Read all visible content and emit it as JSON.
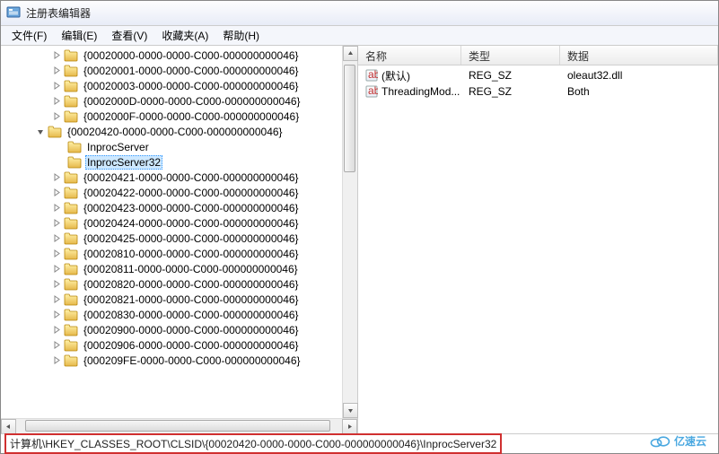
{
  "window": {
    "title": "注册表编辑器"
  },
  "menus": {
    "file": "文件(F)",
    "edit": "编辑(E)",
    "view": "查看(V)",
    "favorites": "收藏夹(A)",
    "help": "帮助(H)"
  },
  "tree": {
    "indent_base": 56,
    "open_key": "{00020420-0000-0000-C000-000000000046}",
    "children": [
      "InprocServer",
      "InprocServer32"
    ],
    "selected_child": "InprocServer32",
    "siblings_before": [
      "{00020000-0000-0000-C000-000000000046}",
      "{00020001-0000-0000-C000-000000000046}",
      "{00020003-0000-0000-C000-000000000046}",
      "{0002000D-0000-0000-C000-000000000046}",
      "{0002000F-0000-0000-C000-000000000046}"
    ],
    "siblings_after": [
      "{00020421-0000-0000-C000-000000000046}",
      "{00020422-0000-0000-C000-000000000046}",
      "{00020423-0000-0000-C000-000000000046}",
      "{00020424-0000-0000-C000-000000000046}",
      "{00020425-0000-0000-C000-000000000046}",
      "{00020810-0000-0000-C000-000000000046}",
      "{00020811-0000-0000-C000-000000000046}",
      "{00020820-0000-0000-C000-000000000046}",
      "{00020821-0000-0000-C000-000000000046}",
      "{00020830-0000-0000-C000-000000000046}",
      "{00020900-0000-0000-C000-000000000046}",
      "{00020906-0000-0000-C000-000000000046}",
      "{000209FE-0000-0000-C000-000000000046}"
    ]
  },
  "list": {
    "headers": {
      "name": "名称",
      "type": "类型",
      "data": "数据"
    },
    "rows": [
      {
        "name": "(默认)",
        "type": "REG_SZ",
        "data": "oleaut32.dll"
      },
      {
        "name": "ThreadingMod...",
        "type": "REG_SZ",
        "data": "Both"
      }
    ]
  },
  "status": {
    "path": "计算机\\HKEY_CLASSES_ROOT\\CLSID\\{00020420-0000-0000-C000-000000000046}\\InprocServer32"
  },
  "watermark": "亿速云"
}
